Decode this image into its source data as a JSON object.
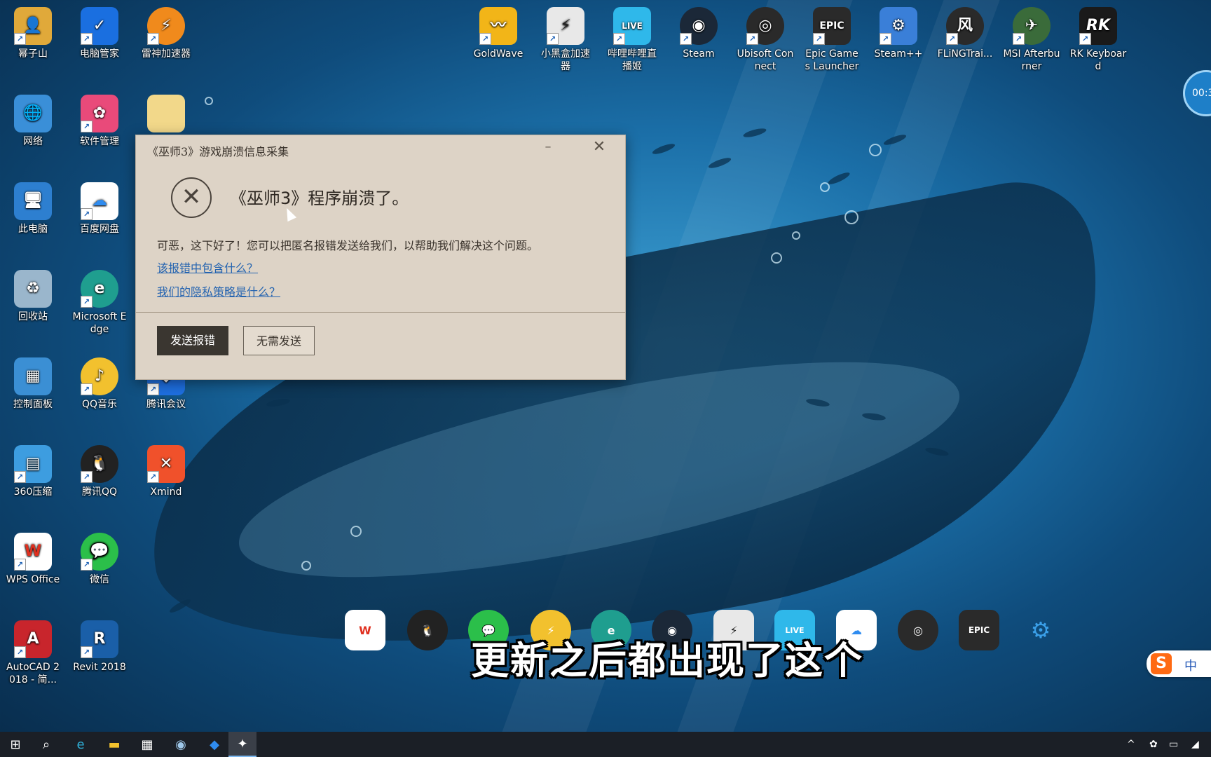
{
  "desktop": {
    "left_icons": [
      {
        "label": "幂子山",
        "icon": "user-folder-icon",
        "color": "#e0a93a"
      },
      {
        "label": "电脑管家",
        "icon": "shield-icon",
        "color": "#1a6fe0"
      },
      {
        "label": "雷神加速器",
        "icon": "thunder-icon",
        "color": "#f08a1c"
      },
      {
        "label": "网络",
        "icon": "network-icon",
        "color": "#3a8fd8"
      },
      {
        "label": "软件管理",
        "icon": "software-manager-icon",
        "color": "#e94a7a"
      },
      {
        "label": "此电脑",
        "icon": "computer-icon",
        "color": "#2d7fd0"
      },
      {
        "label": "百度网盘",
        "icon": "baidu-cloud-icon",
        "color": "#2f8cf0"
      },
      {
        "label": "回收站",
        "icon": "recycle-bin-icon",
        "color": "#9ab6cc"
      },
      {
        "label": "Microsoft Edge",
        "icon": "edge-icon",
        "color": "#1f9e8f"
      },
      {
        "label": "控制面板",
        "icon": "control-panel-icon",
        "color": "#3b8fd4"
      },
      {
        "label": "QQ音乐",
        "icon": "qq-music-icon",
        "color": "#f2c12e"
      },
      {
        "label": "腾讯会议",
        "icon": "tencent-meeting-icon",
        "color": "#1e6fe0"
      },
      {
        "label": "360压缩",
        "icon": "archive-icon",
        "color": "#3d9de0"
      },
      {
        "label": "腾讯QQ",
        "icon": "qq-penguin-icon",
        "color": "#222222"
      },
      {
        "label": "Xmind",
        "icon": "xmind-icon",
        "color": "#f0512b"
      },
      {
        "label": "WPS Office",
        "icon": "wps-icon",
        "color": "#e0301f"
      },
      {
        "label": "微信",
        "icon": "wechat-icon",
        "color": "#2bbf4a"
      },
      {
        "label": "AutoCAD 2018 - 简...",
        "icon": "autocad-icon",
        "color": "#c8252c"
      },
      {
        "label": "Revit 2018",
        "icon": "revit-icon",
        "color": "#1a5fa8"
      }
    ],
    "top_icons": [
      {
        "label": "GoldWave",
        "icon": "goldwave-icon",
        "color": "#f2b518"
      },
      {
        "label": "小黑盒加速器",
        "icon": "heybox-icon",
        "color": "#e8e8e8"
      },
      {
        "label": "哔哩哔哩直播姬",
        "icon": "bilibili-live-icon",
        "color": "#2fb8ea"
      },
      {
        "label": "Steam",
        "icon": "steam-icon",
        "color": "#1b2838"
      },
      {
        "label": "Ubisoft Connect",
        "icon": "ubisoft-icon",
        "color": "#2a2a2a"
      },
      {
        "label": "Epic Games Launcher",
        "icon": "epic-icon",
        "color": "#2a2a2a"
      },
      {
        "label": "Steam++",
        "icon": "steampp-icon",
        "color": "#3a7fd8"
      },
      {
        "label": "FLiNGTrai...",
        "icon": "fling-icon",
        "color": "#2a2a2a"
      },
      {
        "label": "MSI Afterburner",
        "icon": "msi-afterburner-icon",
        "color": "#3a6b3a"
      },
      {
        "label": "RK Keyboard",
        "icon": "rk-keyboard-icon",
        "color": "#1a1a1a"
      }
    ]
  },
  "dialog": {
    "title": "《巫师3》游戏崩溃信息采集",
    "headline": "《巫师3》程序崩溃了。",
    "message": "可恶，这下好了！您可以把匿名报错发送给我们，以帮助我们解决这个问题。",
    "link1": "该报错中包含什么？",
    "link2": "我们的隐私策略是什么？",
    "send_button": "发送报错",
    "no_send_button": "无需发送",
    "minimize_glyph": "–",
    "close_glyph": "✕",
    "error_glyph": "✕"
  },
  "subtitle": "更新之后都出现了这个",
  "ime": {
    "logo": "S",
    "mode": "中"
  },
  "timer": "00:3",
  "taskbar": {
    "items": [
      "start-icon",
      "search-icon",
      "edge-icon",
      "file-explorer-icon",
      "store-icon",
      "steam-icon",
      "app-icon",
      "witcher-icon"
    ],
    "tray_glyph": "^"
  }
}
